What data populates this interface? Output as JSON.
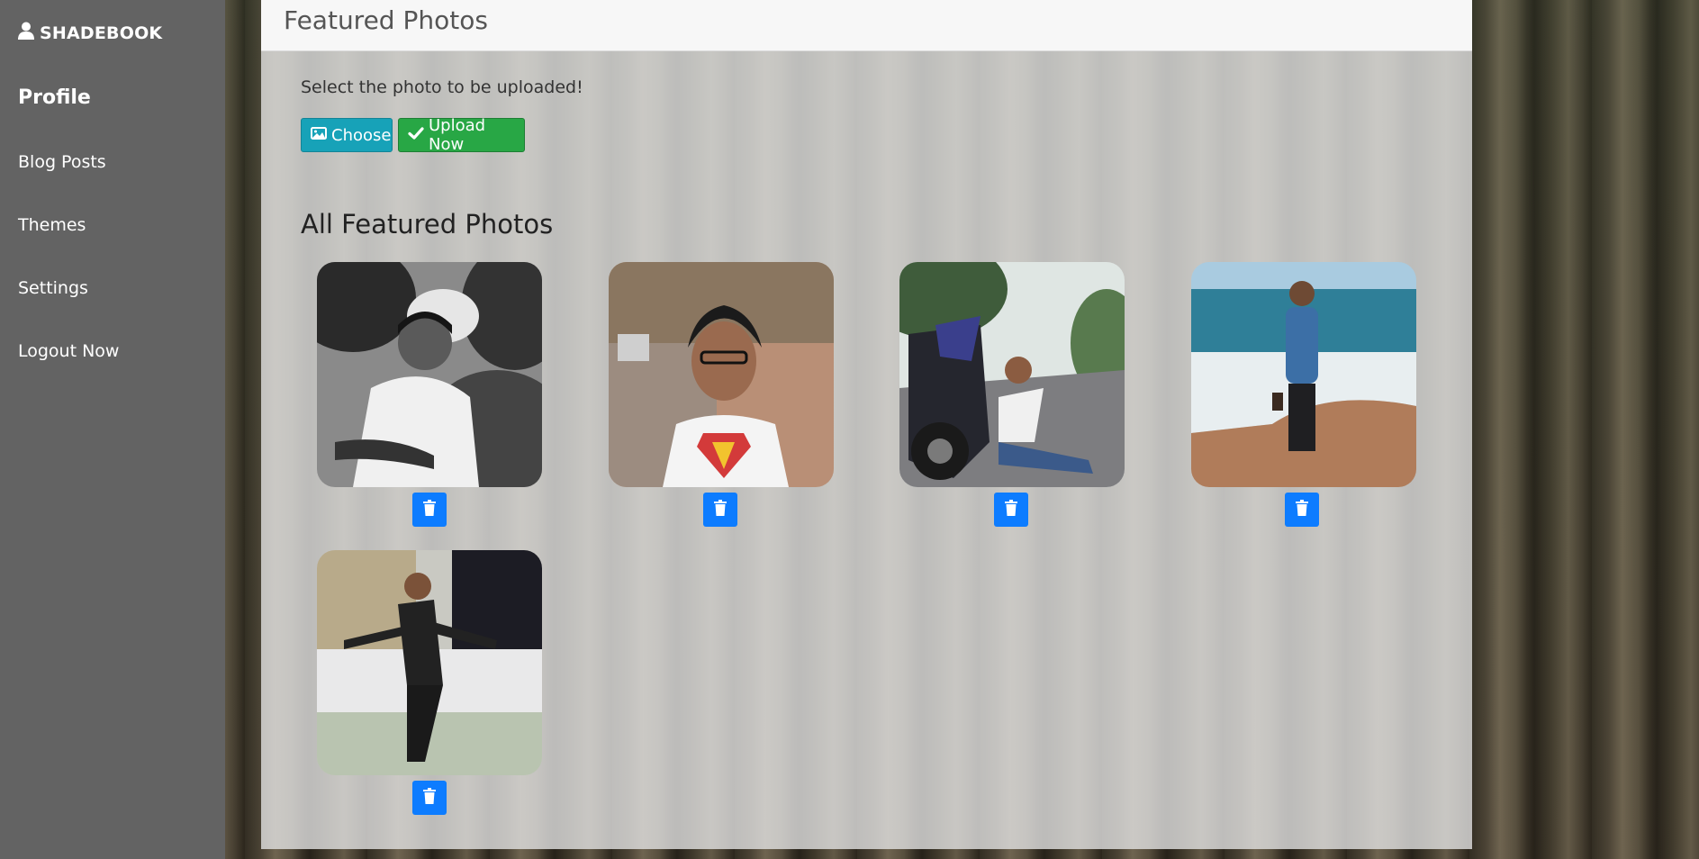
{
  "sidebar": {
    "brand": "SHADEBOOK",
    "items": [
      {
        "label": "Profile",
        "active": true
      },
      {
        "label": "Blog Posts"
      },
      {
        "label": "Themes"
      },
      {
        "label": "Settings"
      },
      {
        "label": "Logout Now"
      }
    ]
  },
  "main": {
    "title": "Featured Photos",
    "upload_hint": "Select the photo to be uploaded!",
    "choose_label": "Choose",
    "upload_label": "Upload Now",
    "section_title": "All Featured Photos",
    "photos": [
      {
        "subject": "black-and-white portrait of man with glasses among trees"
      },
      {
        "subject": "man with glasses in superman t-shirt on street"
      },
      {
        "subject": "man sitting on road beside motorcycle"
      },
      {
        "subject": "man in denim shirt walking on beach"
      },
      {
        "subject": "man in suit standing in front of building at night"
      }
    ]
  },
  "colors": {
    "sidebar_bg": "#636363",
    "choose_button": "#17a2b8",
    "upload_button": "#28a745",
    "delete_button": "#0d7cff"
  },
  "icons": {
    "brand": "user-icon",
    "choose": "image-icon",
    "upload": "check-icon",
    "delete": "trash-icon"
  }
}
